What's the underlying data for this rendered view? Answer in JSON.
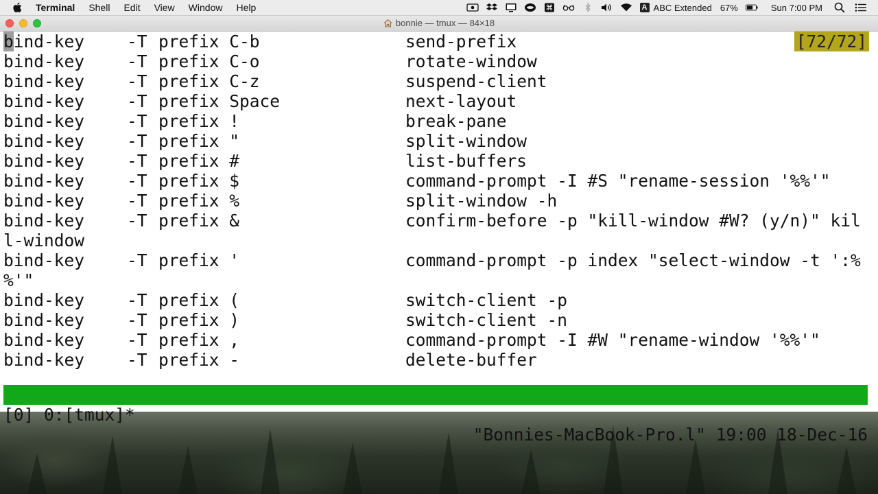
{
  "menubar": {
    "app_name": "Terminal",
    "items": [
      "Shell",
      "Edit",
      "View",
      "Window",
      "Help"
    ],
    "input_source": "ABC Extended",
    "battery": "67%",
    "clock": "Sun 7:00 PM"
  },
  "window": {
    "title": "bonnie — tmux — 84×18"
  },
  "terminal": {
    "position_indicator": "[72/72]",
    "rows": [
      {
        "cmd": "bind-key",
        "flag": "-T",
        "key": "prefix C-b",
        "action": "send-prefix"
      },
      {
        "cmd": "bind-key",
        "flag": "-T",
        "key": "prefix C-o",
        "action": "rotate-window"
      },
      {
        "cmd": "bind-key",
        "flag": "-T",
        "key": "prefix C-z",
        "action": "suspend-client"
      },
      {
        "cmd": "bind-key",
        "flag": "-T",
        "key": "prefix Space",
        "action": "next-layout"
      },
      {
        "cmd": "bind-key",
        "flag": "-T",
        "key": "prefix !",
        "action": "break-pane"
      },
      {
        "cmd": "bind-key",
        "flag": "-T",
        "key": "prefix \"",
        "action": "split-window"
      },
      {
        "cmd": "bind-key",
        "flag": "-T",
        "key": "prefix #",
        "action": "list-buffers"
      },
      {
        "cmd": "bind-key",
        "flag": "-T",
        "key": "prefix $",
        "action": "command-prompt -I #S \"rename-session '%%'\""
      },
      {
        "cmd": "bind-key",
        "flag": "-T",
        "key": "prefix %",
        "action": "split-window -h"
      },
      {
        "cmd": "bind-key",
        "flag": "-T",
        "key": "prefix &",
        "action": "confirm-before -p \"kill-window #W? (y/n)\" kil"
      },
      {
        "wrap": "l-window"
      },
      {
        "cmd": "bind-key",
        "flag": "-T",
        "key": "prefix '",
        "action": "command-prompt -p index \"select-window -t ':%"
      },
      {
        "wrap": "%'\""
      },
      {
        "cmd": "bind-key",
        "flag": "-T",
        "key": "prefix (",
        "action": "switch-client -p"
      },
      {
        "cmd": "bind-key",
        "flag": "-T",
        "key": "prefix )",
        "action": "switch-client -n"
      },
      {
        "cmd": "bind-key",
        "flag": "-T",
        "key": "prefix ,",
        "action": "command-prompt -I #W \"rename-window '%%'\""
      },
      {
        "cmd": "bind-key",
        "flag": "-T",
        "key": "prefix -",
        "action": "delete-buffer"
      }
    ]
  },
  "statusbar": {
    "left": "[0] 0:[tmux]*",
    "right": "\"Bonnies-MacBook-Pro.l\" 19:00 18-Dec-16"
  },
  "colors": {
    "status_bg": "#12a81a",
    "indicator_bg": "#b3a61a"
  }
}
